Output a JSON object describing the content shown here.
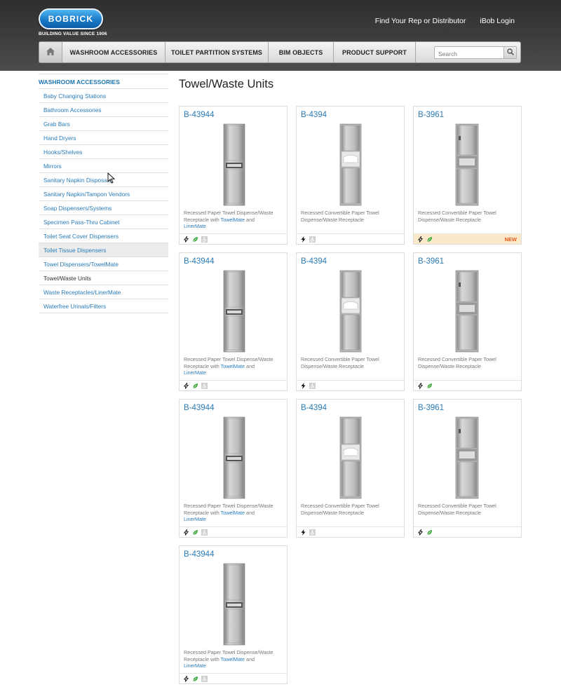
{
  "header": {
    "logo_text": "BOBRICK",
    "tagline": "BUILDING VALUE SINCE 1906",
    "links": [
      "Find Your Rep or Distributor",
      "iBob Login"
    ]
  },
  "nav": {
    "items": [
      "WASHROOM ACCESSORIES",
      "TOILET PARTITION SYSTEMS",
      "BIM OBJECTS",
      "PRODUCT SUPPORT"
    ],
    "search_placeholder": "Search"
  },
  "sidebar": {
    "heading": "WASHROOM ACCESSORIES",
    "items": [
      "Baby Changing Stations",
      "Bathroom Accessories",
      "Grab Bars",
      "Hand Dryers",
      "Hooks/Shelves",
      "Mirrors",
      "Sanitary Napkin Disposals",
      "Sanitary Napkin/Tampon Vendors",
      "Soap Dispensers/Systems",
      "Specimen Pass-Thru Cabinet",
      "Toilet Seat Cover Dispensers",
      "Toilet Tissue Dispensers",
      "Towel Dispensers/TowelMate",
      "Towel/Waste Units",
      "Waste Receptacles/LinerMate",
      "Waterfree Urinals/Filters"
    ],
    "hover_item": "Toilet Tissue Dispensers",
    "current_item": "Towel/Waste Units"
  },
  "main": {
    "title": "Towel/Waste Units",
    "new_label": "NEW",
    "products": [
      {
        "sku": "B-43944",
        "desc_pre": "Recessed Paper Towel Dispense/Waste Receptacle with ",
        "link1": "TowelMate",
        "mid": " and ",
        "link2": "LinerMate",
        "icons": [
          "lightning-outline-icon",
          "green-leaf-icon",
          "accessible-icon"
        ],
        "is_new": false
      },
      {
        "sku": "B-4394",
        "desc_pre": "Recessed Convertible Paper Towel Dispense/Waste Receptacle",
        "link1": "",
        "mid": "",
        "link2": "",
        "icons": [
          "lightning-icon",
          "accessible-icon"
        ],
        "is_new": false
      },
      {
        "sku": "B-3961",
        "desc_pre": "Recessed Convertible Paper Towel Dispense/Waste Receptacle",
        "link1": "",
        "mid": "",
        "link2": "",
        "icons": [
          "lightning-outline-icon",
          "green-leaf-icon"
        ],
        "is_new": true
      },
      {
        "sku": "B-43944",
        "desc_pre": "Recessed Paper Towel Dispense/Waste Receptacle with ",
        "link1": "TowelMate",
        "mid": " and ",
        "link2": "LinerMate",
        "icons": [
          "lightning-outline-icon",
          "green-leaf-icon",
          "accessible-icon"
        ],
        "is_new": false
      },
      {
        "sku": "B-4394",
        "desc_pre": "Recessed Convertible Paper Towel Dispense/Waste Receptacle",
        "link1": "",
        "mid": "",
        "link2": "",
        "icons": [
          "lightning-icon",
          "accessible-icon"
        ],
        "is_new": false
      },
      {
        "sku": "B-3961",
        "desc_pre": "Recessed Convertible Paper Towel Dispense/Waste Receptacle",
        "link1": "",
        "mid": "",
        "link2": "",
        "icons": [
          "lightning-outline-icon",
          "green-leaf-icon"
        ],
        "is_new": false
      },
      {
        "sku": "B-43944",
        "desc_pre": "Recessed Paper Towel Dispense/Waste Receptacle with ",
        "link1": "TowelMate",
        "mid": " and ",
        "link2": "LinerMate",
        "icons": [
          "lightning-outline-icon",
          "green-leaf-icon",
          "accessible-icon"
        ],
        "is_new": false
      },
      {
        "sku": "B-4394",
        "desc_pre": "Recessed Convertible Paper Towel Dispense/Waste Receptacle",
        "link1": "",
        "mid": "",
        "link2": "",
        "icons": [
          "lightning-icon",
          "accessible-icon"
        ],
        "is_new": false
      },
      {
        "sku": "B-3961",
        "desc_pre": "Recessed Convertible Paper Towel Dispense/Waste Receptacle",
        "link1": "",
        "mid": "",
        "link2": "",
        "icons": [
          "lightning-outline-icon",
          "green-leaf-icon"
        ],
        "is_new": false
      },
      {
        "sku": "B-43944",
        "desc_pre": "Recessed Paper Towel Dispense/Waste Receptacle with ",
        "link1": "TowelMate",
        "mid": " and ",
        "link2": "LinerMate",
        "icons": [
          "lightning-outline-icon",
          "green-leaf-icon",
          "accessible-icon"
        ],
        "is_new": false
      }
    ]
  },
  "colors": {
    "link": "#2a7bb8",
    "new_badge": "#e5581e",
    "new_bg": "#fbe9c9",
    "leaf": "#3aa63a"
  }
}
